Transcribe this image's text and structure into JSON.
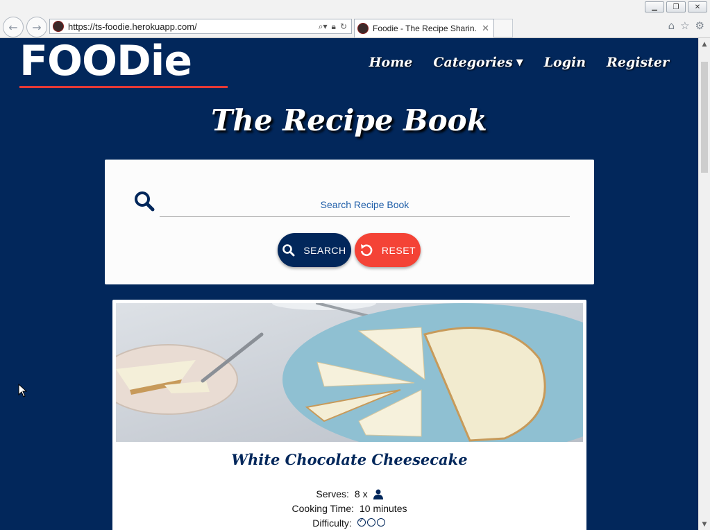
{
  "browser": {
    "url": "https://ts-foodie.herokuapp.com/",
    "tab_title": "Foodie - The Recipe Sharin...",
    "window_buttons": [
      "minimize",
      "restore",
      "close"
    ]
  },
  "site": {
    "logo_text": "FOODie",
    "nav": {
      "home": "Home",
      "categories": "Categories",
      "login": "Login",
      "register": "Register"
    },
    "page_title": "The Recipe Book"
  },
  "search": {
    "placeholder": "Search Recipe Book",
    "value": "",
    "search_label": "SEARCH",
    "reset_label": "RESET"
  },
  "recipe": {
    "title": "White Chocolate Cheesecake",
    "serves_label": "Serves:",
    "serves_value": "8 x",
    "cooking_label": "Cooking Time:",
    "cooking_value": "10 minutes",
    "difficulty_label": "Difficulty:",
    "difficulty_level": 1,
    "difficulty_max": 3
  },
  "colors": {
    "navy": "#02275b",
    "red": "#f44336",
    "white": "#ffffff"
  }
}
